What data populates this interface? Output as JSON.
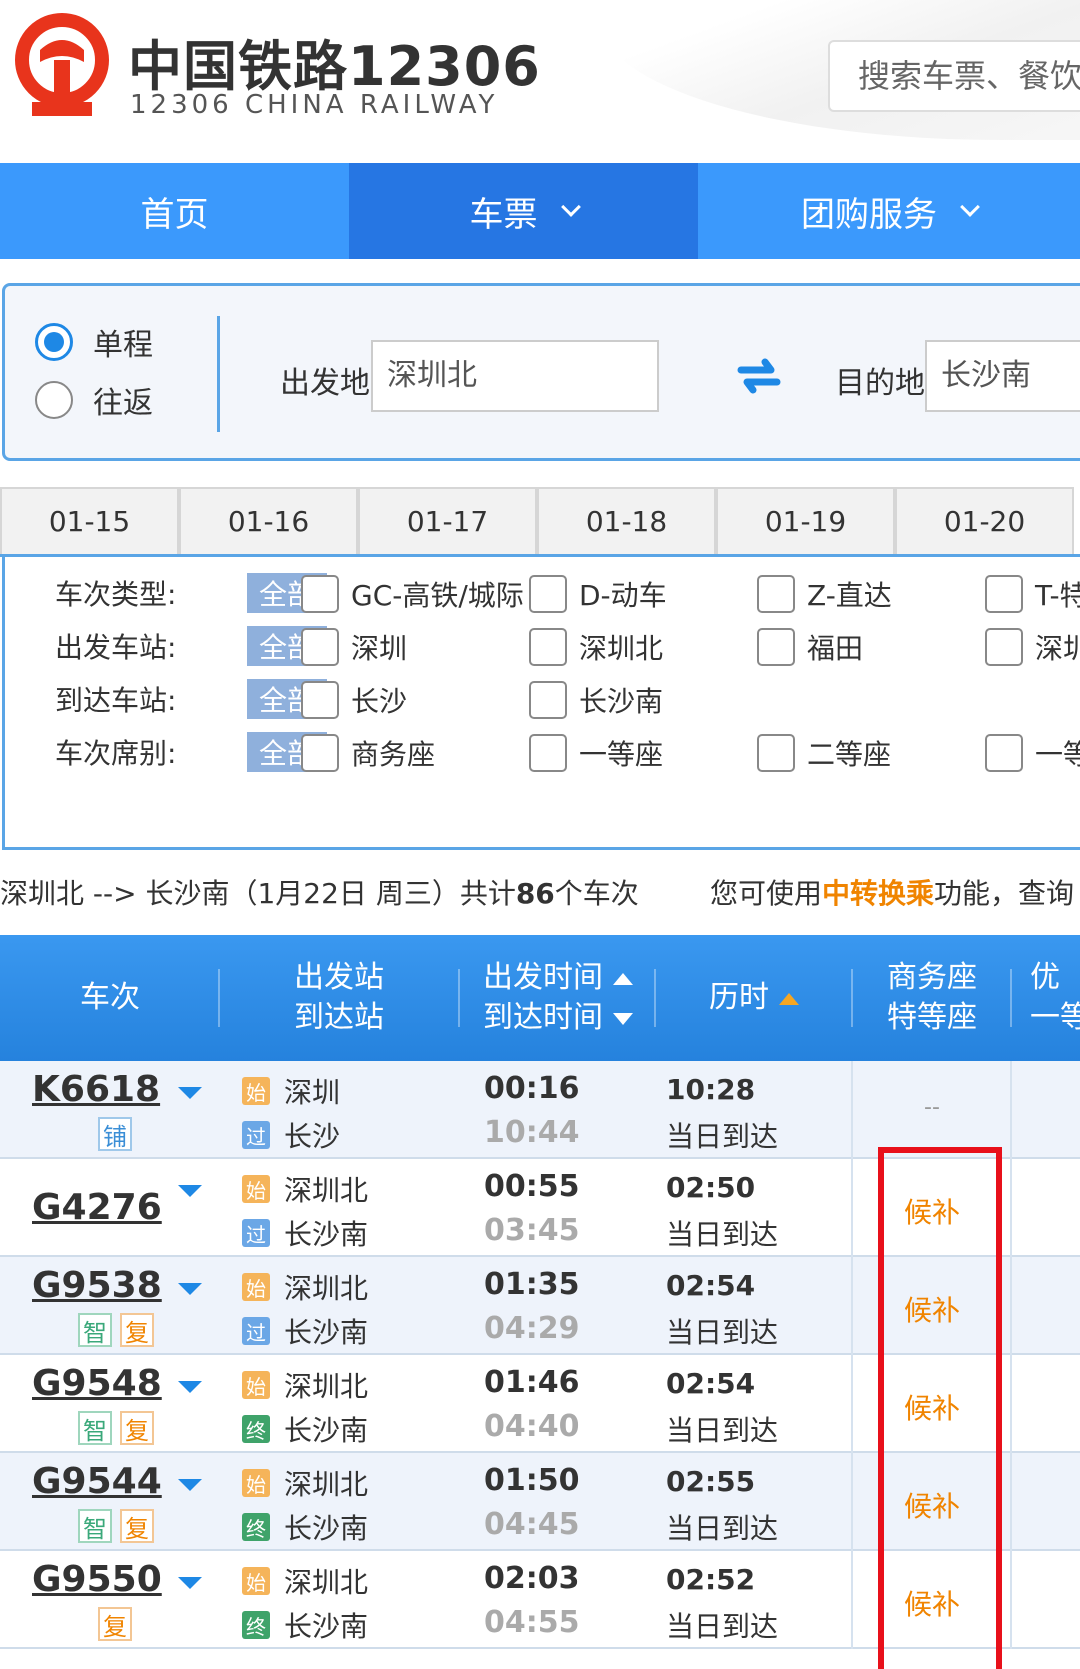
{
  "header": {
    "brand_cn": "中国铁路12306",
    "brand_en": "12306 CHINA RAILWAY",
    "search_placeholder": "搜索车票、餐饮",
    "logo_color": "#e8341c"
  },
  "nav": {
    "items": [
      {
        "label": "首页",
        "has_dropdown": false,
        "active": false
      },
      {
        "label": "车票",
        "has_dropdown": true,
        "active": true
      },
      {
        "label": "团购服务",
        "has_dropdown": true,
        "active": false
      }
    ]
  },
  "form": {
    "trip_one_way": "单程",
    "trip_round": "往返",
    "from_label": "出发地",
    "from_value": "深圳北",
    "to_label": "目的地",
    "to_value": "长沙南"
  },
  "dates": [
    "01-15",
    "01-16",
    "01-17",
    "01-18",
    "01-19",
    "01-20"
  ],
  "filters": {
    "all_label": "全部",
    "rows": [
      {
        "label": "车次类型:",
        "options": [
          "GC-高铁/城际",
          "D-动车",
          "Z-直达",
          "T-特"
        ]
      },
      {
        "label": "出发车站:",
        "options": [
          "深圳",
          "深圳北",
          "福田",
          "深圳"
        ]
      },
      {
        "label": "到达车站:",
        "options": [
          "长沙",
          "长沙南"
        ]
      },
      {
        "label": "车次席别:",
        "options": [
          "商务座",
          "一等座",
          "二等座",
          "一等"
        ]
      }
    ]
  },
  "summary": {
    "route": "深圳北 --> 长沙南（1月22日  周三）共计",
    "count": "86",
    "count_suffix": "个车次",
    "hint_prefix": "您可使用",
    "hint_link": "中转换乘",
    "hint_suffix": "功能，查询"
  },
  "table": {
    "headers": {
      "train": "车次",
      "station_top": "出发站",
      "station_bottom": "到达站",
      "time_top": "出发时间",
      "time_bottom": "到达时间",
      "duration": "历时",
      "business_top": "商务座",
      "business_bottom": "特等座",
      "next_top": "优",
      "next_bottom": "一等"
    },
    "rows": [
      {
        "train": "K6618",
        "tags": [
          "铺"
        ],
        "from_badge": "始",
        "from": "深圳",
        "to_badge": "过",
        "to": "长沙",
        "dep": "00:16",
        "arr": "10:44",
        "duration": "10:28",
        "arrive_day": "当日到达",
        "business": "--"
      },
      {
        "train": "G4276",
        "tags": [],
        "from_badge": "始",
        "from": "深圳北",
        "to_badge": "过",
        "to": "长沙南",
        "dep": "00:55",
        "arr": "03:45",
        "duration": "02:50",
        "arrive_day": "当日到达",
        "business": "候补"
      },
      {
        "train": "G9538",
        "tags": [
          "智",
          "复"
        ],
        "from_badge": "始",
        "from": "深圳北",
        "to_badge": "过",
        "to": "长沙南",
        "dep": "01:35",
        "arr": "04:29",
        "duration": "02:54",
        "arrive_day": "当日到达",
        "business": "候补"
      },
      {
        "train": "G9548",
        "tags": [
          "智",
          "复"
        ],
        "from_badge": "始",
        "from": "深圳北",
        "to_badge": "终",
        "to": "长沙南",
        "dep": "01:46",
        "arr": "04:40",
        "duration": "02:54",
        "arrive_day": "当日到达",
        "business": "候补"
      },
      {
        "train": "G9544",
        "tags": [
          "智",
          "复"
        ],
        "from_badge": "始",
        "from": "深圳北",
        "to_badge": "终",
        "to": "长沙南",
        "dep": "01:50",
        "arr": "04:45",
        "duration": "02:55",
        "arrive_day": "当日到达",
        "business": "候补"
      },
      {
        "train": "G9550",
        "tags": [
          "复"
        ],
        "from_badge": "始",
        "from": "深圳北",
        "to_badge": "终",
        "to": "长沙南",
        "dep": "02:03",
        "arr": "04:55",
        "duration": "02:52",
        "arrive_day": "当日到达",
        "business": "候补"
      }
    ]
  },
  "colors": {
    "nav_blue": "#3b99fc",
    "nav_active": "#2676e3",
    "highlight_orange": "#f08400",
    "annotation_red": "#e8101a"
  }
}
